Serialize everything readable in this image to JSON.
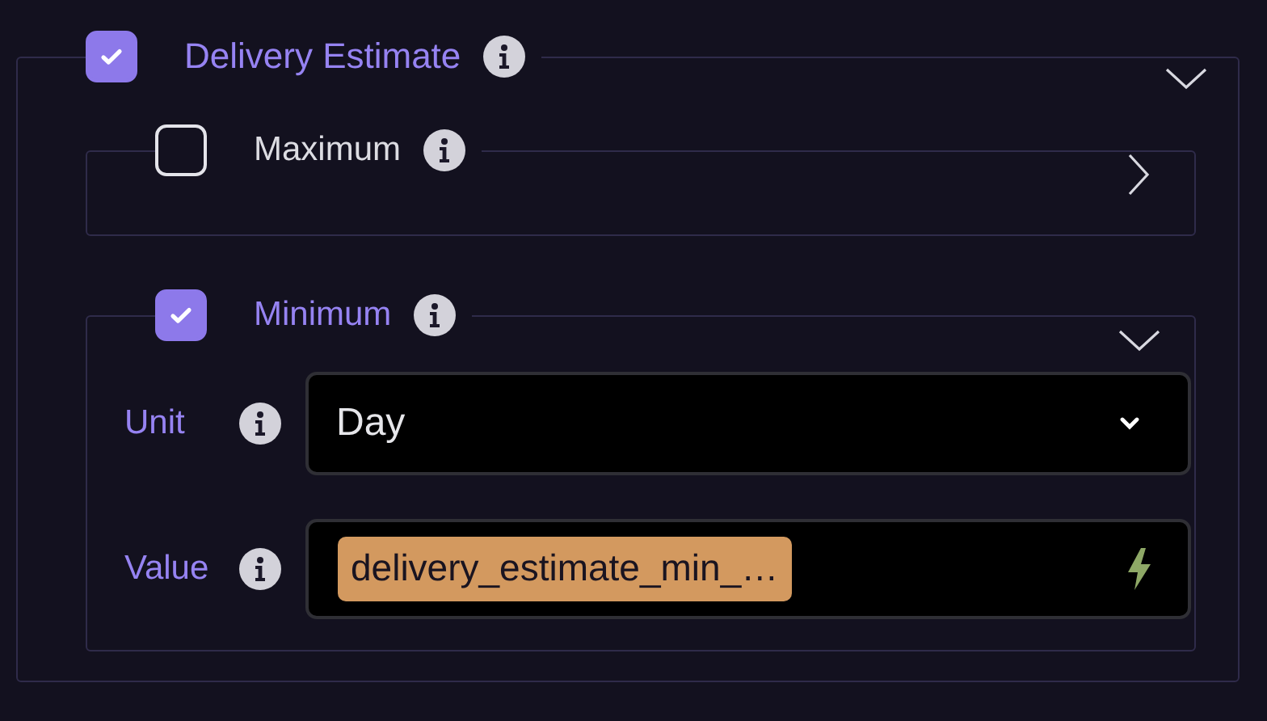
{
  "section": {
    "title": "Delivery Estimate",
    "checked": true,
    "expanded": true,
    "children": [
      {
        "title": "Maximum",
        "checked": false,
        "expanded": false
      },
      {
        "title": "Minimum",
        "checked": true,
        "expanded": true,
        "fields": [
          {
            "kind": "select",
            "label": "Unit",
            "value": "Day"
          },
          {
            "kind": "token",
            "label": "Value",
            "token": "delivery_estimate_min_…"
          }
        ]
      }
    ]
  }
}
